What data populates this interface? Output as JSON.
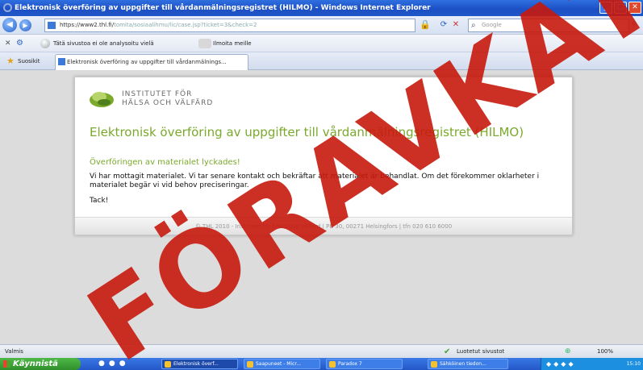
{
  "window": {
    "title": "Elektronisk överföring av uppgifter till vårdanmälningsregistret (HILMO) - Windows Internet Explorer",
    "minimize": "_",
    "maximize": "□",
    "close": "✕"
  },
  "address_bar": {
    "url_start": "https://www2.thl.fi/",
    "url_rest": "tomita/sosiaalihmu/lic/case.jsp?ticket=3&check=2",
    "search_placeholder": "Google"
  },
  "links_bar": {
    "site_not_analyzed": "Tätä sivustoa ei ole analysoitu vielä",
    "share": "Ilmoita meille"
  },
  "favorites_bar": {
    "label": "Suosikit",
    "tab_title": "Elektronisk överföring av uppgifter till vårdanmälnings..."
  },
  "page": {
    "logo_line1": "INSTITUTET FÖR",
    "logo_line2": "HÄLSA OCH VÄLFÄRD",
    "title": "Elektronisk överföring av uppgifter till vårdanmälningsregistret (HILMO)",
    "success": "Överföringen av materialet lyckades!",
    "body": "Vi har mottagit materialet. Vi tar senare kontakt och bekräftar att materialet är behandlat. Om det förekommer oklarheter i materialet begär vi vid behov preciseringar.",
    "thanks": "Tack!",
    "footer": "© THL 2010 - Institutet för hälsa och välfärd | PB 30, 00271 Helsingfors | tfn 020 610 6000"
  },
  "status_bar": {
    "left": "Valmis",
    "trusted": "Luotetut sivustot",
    "zoom": "100%"
  },
  "taskbar": {
    "start": "Käynnistä",
    "tasks": [
      "Elektronisk överf...",
      "Saapuneet - Micr...",
      "Paradox 7",
      "Sähköinen tiedon..."
    ],
    "clock": "15:10"
  },
  "watermark": "FÖRAVKAT"
}
